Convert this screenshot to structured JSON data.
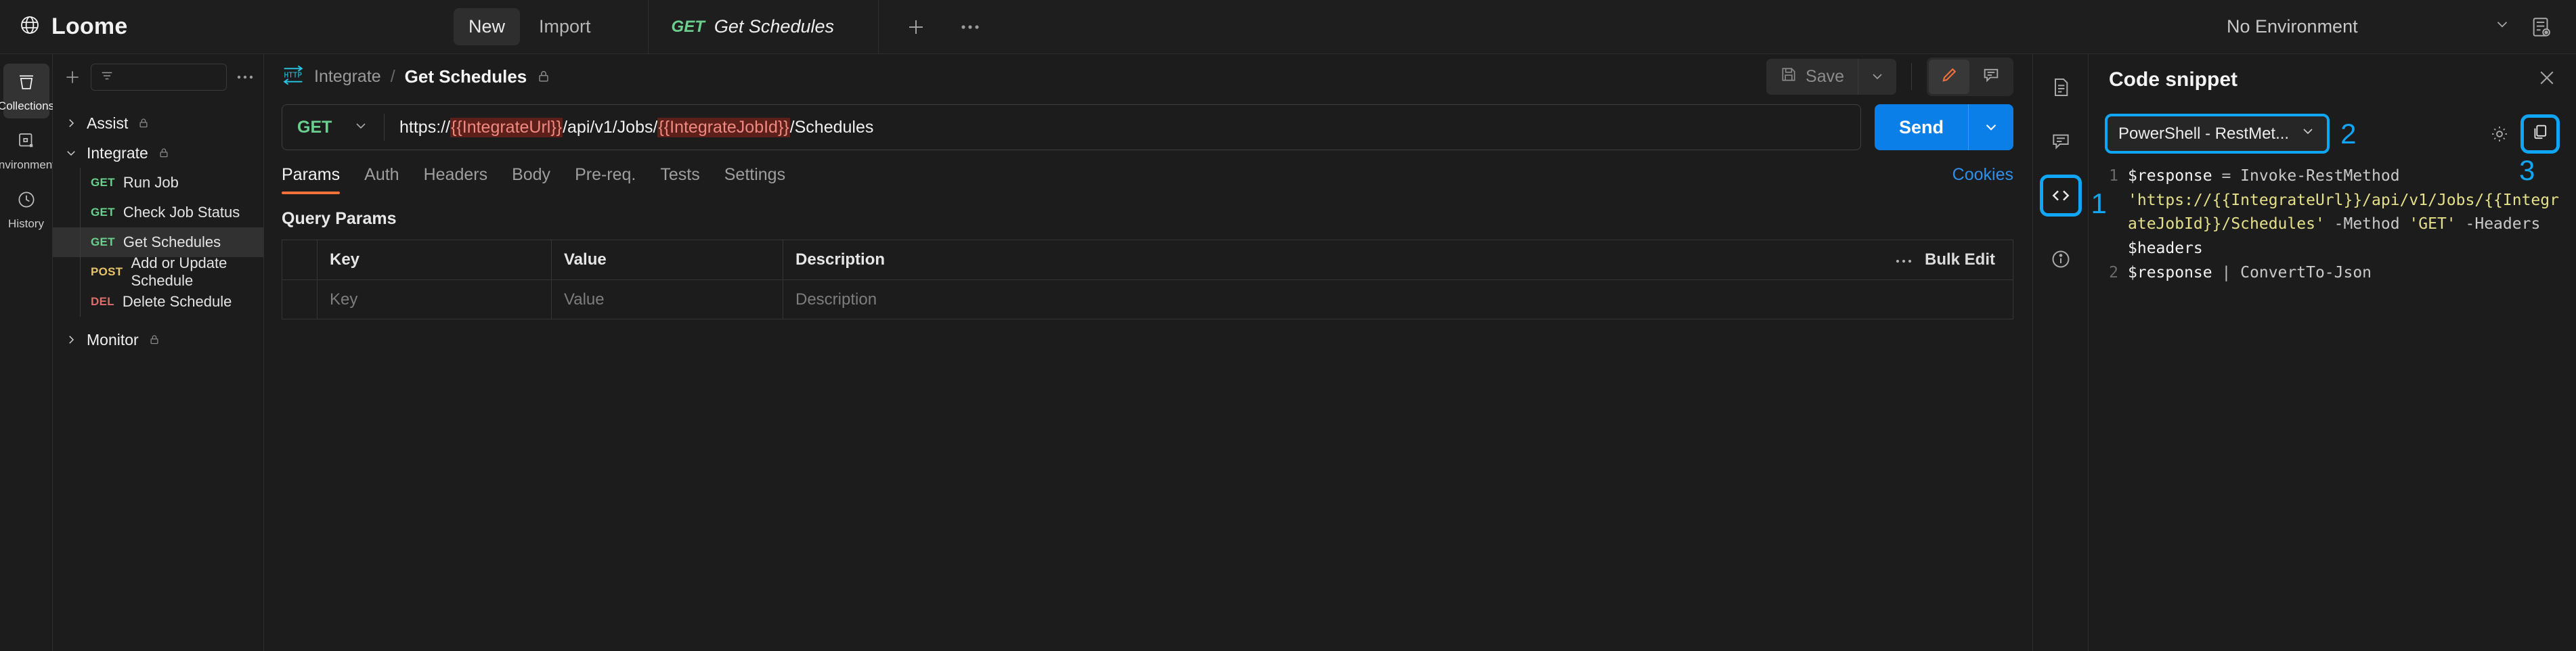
{
  "app": {
    "brand": "Loome",
    "brand_icon": "globe-icon"
  },
  "topbar": {
    "new_label": "New",
    "import_label": "Import",
    "tab": {
      "method": "GET",
      "title": "Get Schedules"
    },
    "add_tab_icon": "plus-icon",
    "tab_overflow_icon": "ellipsis-icon",
    "environment": {
      "value": "No Environment",
      "caret_icon": "chevron-down-icon"
    },
    "env_preview_icon": "environment-preview-icon"
  },
  "rail": {
    "items": [
      {
        "label": "Collections",
        "icon": "collections-icon",
        "active": true
      },
      {
        "label": "Environments",
        "icon": "environments-icon",
        "active": false
      },
      {
        "label": "History",
        "icon": "history-icon",
        "active": false
      }
    ]
  },
  "collections": {
    "toolbar": {
      "add_icon": "plus-icon",
      "filter_icon": "filter-icon",
      "search_placeholder": "",
      "more_icon": "ellipsis-icon"
    },
    "tree": [
      {
        "type": "folder",
        "name": "Assist",
        "expanded": false,
        "locked": true,
        "chevron": "chevron-right-icon"
      },
      {
        "type": "folder",
        "name": "Integrate",
        "expanded": true,
        "locked": true,
        "chevron": "chevron-down-icon"
      },
      {
        "type": "request",
        "method": "GET",
        "name": "Run Job",
        "selected": false
      },
      {
        "type": "request",
        "method": "GET",
        "name": "Check Job Status",
        "selected": false
      },
      {
        "type": "request",
        "method": "GET",
        "name": "Get Schedules",
        "selected": true
      },
      {
        "type": "request",
        "method": "POST",
        "name": "Add or Update Schedule",
        "selected": false
      },
      {
        "type": "request",
        "method": "DEL",
        "name": "Delete Schedule",
        "selected": false
      },
      {
        "type": "folder",
        "name": "Monitor",
        "expanded": false,
        "locked": true,
        "chevron": "chevron-right-icon"
      }
    ]
  },
  "request": {
    "breadcrumb": {
      "icon": "http-icon",
      "parent": "Integrate",
      "separator": "/",
      "current": "Get Schedules",
      "lock_icon": "lock-icon"
    },
    "save": {
      "label": "Save",
      "icon": "save-icon",
      "caret_icon": "chevron-down-icon"
    },
    "mode": {
      "edit_icon": "pencil-icon",
      "comment_icon": "comment-icon"
    },
    "method": {
      "value": "GET",
      "caret_icon": "chevron-down-icon"
    },
    "url": {
      "parts": [
        {
          "text": "https://",
          "variable": false
        },
        {
          "text": "{{IntegrateUrl}}",
          "variable": true
        },
        {
          "text": "/api/v1/Jobs/",
          "variable": false
        },
        {
          "text": "{{IntegrateJobId}}",
          "variable": true
        },
        {
          "text": "/Schedules",
          "variable": false
        }
      ]
    },
    "send": {
      "label": "Send",
      "caret_icon": "chevron-down-icon"
    },
    "tabs": [
      {
        "label": "Params",
        "active": true
      },
      {
        "label": "Auth",
        "active": false
      },
      {
        "label": "Headers",
        "active": false
      },
      {
        "label": "Body",
        "active": false
      },
      {
        "label": "Pre-req.",
        "active": false
      },
      {
        "label": "Tests",
        "active": false
      },
      {
        "label": "Settings",
        "active": false
      }
    ],
    "cookies_label": "Cookies",
    "query_params": {
      "title": "Query Params",
      "columns": [
        "Key",
        "Value",
        "Description"
      ],
      "more_icon": "ellipsis-icon",
      "bulk_edit_label": "Bulk Edit",
      "empty_row": {
        "key_placeholder": "Key",
        "value_placeholder": "Value",
        "description_placeholder": "Description"
      }
    }
  },
  "strip": {
    "items": [
      {
        "icon": "document-icon",
        "highlighted": false
      },
      {
        "icon": "comment-icon",
        "highlighted": false
      },
      {
        "icon": "code-icon",
        "highlighted": true
      },
      {
        "icon": "info-icon",
        "highlighted": false
      }
    ]
  },
  "code_panel": {
    "title": "Code snippet",
    "close_icon": "close-icon",
    "language": {
      "value": "PowerShell - RestMet...",
      "caret_icon": "chevron-down-icon"
    },
    "settings_icon": "gear-icon",
    "copy_icon": "copy-icon",
    "lines": [
      {
        "number": "1",
        "tokens": [
          {
            "text": "$response",
            "kind": "var"
          },
          {
            "text": " = ",
            "kind": "op"
          },
          {
            "text": "Invoke-RestMethod",
            "kind": "fn"
          },
          {
            "text": " ",
            "kind": "op"
          },
          {
            "text": "'https://{{IntegrateUrl}}/api/v1/Jobs/{{IntegrateJobId}}/Schedules'",
            "kind": "str"
          },
          {
            "text": " -Method ",
            "kind": "fn"
          },
          {
            "text": "'GET'",
            "kind": "str"
          },
          {
            "text": " -Headers ",
            "kind": "fn"
          },
          {
            "text": "$headers",
            "kind": "var"
          }
        ]
      },
      {
        "number": "2",
        "tokens": [
          {
            "text": "$response",
            "kind": "var"
          },
          {
            "text": " | ",
            "kind": "op"
          },
          {
            "text": "ConvertTo-Json",
            "kind": "fn"
          }
        ]
      }
    ]
  },
  "annotations": [
    {
      "label": "1",
      "target": "code-icon-strip-button"
    },
    {
      "label": "2",
      "target": "language-select"
    },
    {
      "label": "3",
      "target": "copy-button"
    }
  ],
  "colors": {
    "accent_blue": "#0b7fe8",
    "highlight_blue": "#10a6f5",
    "accent_orange": "#f2703a",
    "method_get": "#6bcf8e",
    "method_post": "#e8c36b",
    "method_delete": "#e06c6c",
    "var_bg": "#5c1f1a",
    "var_fg": "#ef8a82",
    "code_string": "#e4e08a"
  }
}
